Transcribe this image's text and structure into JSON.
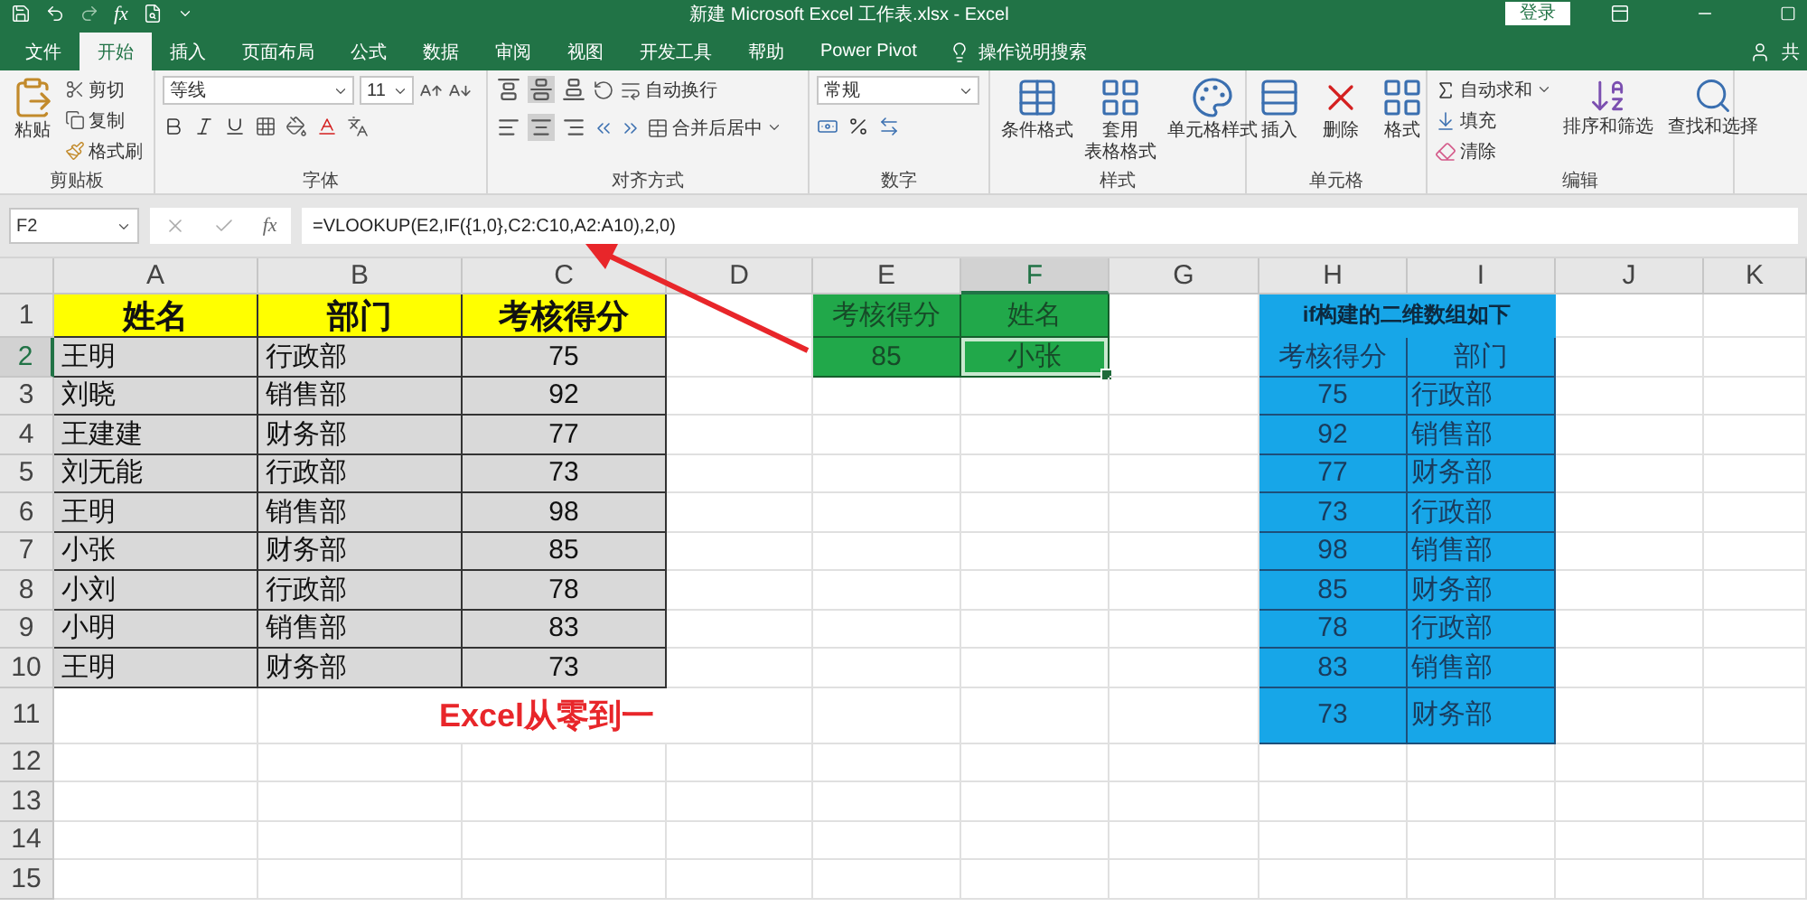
{
  "window": {
    "title": "新建 Microsoft Excel 工作表.xlsx  -  Excel",
    "sign_in": "登录",
    "quick_fx": "fx"
  },
  "tabs": [
    {
      "label": "文件",
      "selected": false
    },
    {
      "label": "开始",
      "selected": true
    },
    {
      "label": "插入",
      "selected": false
    },
    {
      "label": "页面布局",
      "selected": false
    },
    {
      "label": "公式",
      "selected": false
    },
    {
      "label": "数据",
      "selected": false
    },
    {
      "label": "审阅",
      "selected": false
    },
    {
      "label": "视图",
      "selected": false
    },
    {
      "label": "开发工具",
      "selected": false
    },
    {
      "label": "帮助",
      "selected": false
    },
    {
      "label": "Power Pivot",
      "selected": false
    }
  ],
  "tell_me": "操作说明搜索",
  "share": "共",
  "ribbon": {
    "clipboard": {
      "label": "剪贴板",
      "paste": "粘贴",
      "cut": "剪切",
      "copy": "复制",
      "painter": "格式刷"
    },
    "font": {
      "label": "字体",
      "font_name": "等线",
      "font_size": "11"
    },
    "alignment": {
      "label": "对齐方式",
      "wrap": "自动换行",
      "merge": "合并后居中"
    },
    "number": {
      "label": "数字",
      "format": "常规"
    },
    "styles": {
      "label": "样式",
      "conditional": "条件格式",
      "table": [
        "套用",
        "表格格式"
      ],
      "cell": "单元格样式"
    },
    "cells": {
      "label": "单元格",
      "insert": "插入",
      "delete": "删除",
      "format": "格式"
    },
    "editing": {
      "label": "编辑",
      "autosum": "自动求和",
      "fill": "填充",
      "clear": "清除",
      "sort": "排序和筛选",
      "find": "查找和选择"
    }
  },
  "formula_bar": {
    "name_box": "F2",
    "fx": "fx",
    "formula": "=VLOOKUP(E2,IF({1,0},C2:C10,A2:A10),2,0)"
  },
  "sheet": {
    "columns": [
      {
        "label": "A",
        "selected": false
      },
      {
        "label": "B",
        "selected": false
      },
      {
        "label": "C",
        "selected": false
      },
      {
        "label": "D",
        "selected": false
      },
      {
        "label": "E",
        "selected": false
      },
      {
        "label": "F",
        "selected": true
      },
      {
        "label": "G",
        "selected": false
      },
      {
        "label": "H",
        "selected": false
      },
      {
        "label": "I",
        "selected": false
      },
      {
        "label": "J",
        "selected": false
      },
      {
        "label": "K",
        "selected": false
      }
    ],
    "rows": [
      {
        "number": "1",
        "selected": false,
        "cells": [
          {
            "kind": "yellow-head",
            "text": "姓名"
          },
          {
            "kind": "yellow-head",
            "text": "部门"
          },
          {
            "kind": "yellow-head",
            "text": "考核得分"
          },
          {
            "kind": "blank"
          },
          {
            "kind": "green",
            "text": "考核得分"
          },
          {
            "kind": "green",
            "text": "姓名"
          },
          {
            "kind": "blank"
          },
          {
            "kind": "blue-title",
            "text": "if构建的二维数组如下"
          }
        ]
      },
      {
        "number": "2",
        "selected": true,
        "cells": [
          {
            "kind": "gray",
            "text": "王明"
          },
          {
            "kind": "gray",
            "text": "行政部"
          },
          {
            "kind": "gray-num",
            "text": "75"
          },
          {
            "kind": "blank"
          },
          {
            "kind": "green",
            "text": "85"
          },
          {
            "kind": "green-selected",
            "text": "小张"
          },
          {
            "kind": "blank"
          },
          {
            "kind": "blue-num",
            "text": "考核得分"
          },
          {
            "kind": "blue-num",
            "text": "部门"
          }
        ]
      },
      {
        "number": "3",
        "selected": false,
        "cells": [
          {
            "kind": "gray",
            "text": "刘晓"
          },
          {
            "kind": "gray",
            "text": "销售部"
          },
          {
            "kind": "gray-num",
            "text": "92"
          },
          {
            "kind": "blank"
          },
          {
            "kind": "blank"
          },
          {
            "kind": "blank"
          },
          {
            "kind": "blank"
          },
          {
            "kind": "blue-num",
            "text": "75"
          },
          {
            "kind": "blue",
            "text": "行政部"
          }
        ]
      },
      {
        "number": "4",
        "selected": false,
        "cells": [
          {
            "kind": "gray",
            "text": "王建建"
          },
          {
            "kind": "gray",
            "text": "财务部"
          },
          {
            "kind": "gray-num",
            "text": "77"
          },
          {
            "kind": "blank"
          },
          {
            "kind": "blank"
          },
          {
            "kind": "blank"
          },
          {
            "kind": "blank"
          },
          {
            "kind": "blue-num",
            "text": "92"
          },
          {
            "kind": "blue",
            "text": "销售部"
          }
        ]
      },
      {
        "number": "5",
        "selected": false,
        "cells": [
          {
            "kind": "gray",
            "text": "刘无能"
          },
          {
            "kind": "gray",
            "text": "行政部"
          },
          {
            "kind": "gray-num",
            "text": "73"
          },
          {
            "kind": "blank"
          },
          {
            "kind": "blank"
          },
          {
            "kind": "blank"
          },
          {
            "kind": "blank"
          },
          {
            "kind": "blue-num",
            "text": "77"
          },
          {
            "kind": "blue",
            "text": "财务部"
          }
        ]
      },
      {
        "number": "6",
        "selected": false,
        "cells": [
          {
            "kind": "gray",
            "text": "王明"
          },
          {
            "kind": "gray",
            "text": "销售部"
          },
          {
            "kind": "gray-num",
            "text": "98"
          },
          {
            "kind": "blank"
          },
          {
            "kind": "blank"
          },
          {
            "kind": "blank"
          },
          {
            "kind": "blank"
          },
          {
            "kind": "blue-num",
            "text": "73"
          },
          {
            "kind": "blue",
            "text": "行政部"
          }
        ]
      },
      {
        "number": "7",
        "selected": false,
        "cells": [
          {
            "kind": "gray",
            "text": "小张"
          },
          {
            "kind": "gray",
            "text": "财务部"
          },
          {
            "kind": "gray-num",
            "text": "85"
          },
          {
            "kind": "blank"
          },
          {
            "kind": "blank"
          },
          {
            "kind": "blank"
          },
          {
            "kind": "blank"
          },
          {
            "kind": "blue-num",
            "text": "98"
          },
          {
            "kind": "blue",
            "text": "销售部"
          }
        ]
      },
      {
        "number": "8",
        "selected": false,
        "cells": [
          {
            "kind": "gray",
            "text": "小刘"
          },
          {
            "kind": "gray",
            "text": "行政部"
          },
          {
            "kind": "gray-num",
            "text": "78"
          },
          {
            "kind": "blank"
          },
          {
            "kind": "blank"
          },
          {
            "kind": "blank"
          },
          {
            "kind": "blank"
          },
          {
            "kind": "blue-num",
            "text": "85"
          },
          {
            "kind": "blue",
            "text": "财务部"
          }
        ]
      },
      {
        "number": "9",
        "selected": false,
        "cells": [
          {
            "kind": "gray",
            "text": "小明"
          },
          {
            "kind": "gray",
            "text": "销售部"
          },
          {
            "kind": "gray-num",
            "text": "83"
          },
          {
            "kind": "blank"
          },
          {
            "kind": "blank"
          },
          {
            "kind": "blank"
          },
          {
            "kind": "blank"
          },
          {
            "kind": "blue-num",
            "text": "78"
          },
          {
            "kind": "blue",
            "text": "行政部"
          }
        ]
      },
      {
        "number": "10",
        "selected": false,
        "cells": [
          {
            "kind": "gray",
            "text": "王明"
          },
          {
            "kind": "gray",
            "text": "财务部"
          },
          {
            "kind": "gray-num",
            "text": "73"
          },
          {
            "kind": "blank"
          },
          {
            "kind": "blank"
          },
          {
            "kind": "blank"
          },
          {
            "kind": "blank"
          },
          {
            "kind": "blue-num",
            "text": "83"
          },
          {
            "kind": "blue",
            "text": "销售部"
          }
        ]
      },
      {
        "number": "11",
        "selected": false,
        "cells": [
          {
            "kind": "blank"
          },
          {
            "kind": "note",
            "text": "Excel从零到一"
          },
          {
            "kind": "blank"
          },
          {
            "kind": "blank"
          },
          {
            "kind": "blank"
          },
          {
            "kind": "blue-num",
            "text": "73"
          },
          {
            "kind": "blue",
            "text": "财务部"
          }
        ]
      },
      {
        "number": "12",
        "selected": false
      },
      {
        "number": "13",
        "selected": false
      },
      {
        "number": "14",
        "selected": false
      },
      {
        "number": "15",
        "selected": false
      }
    ]
  }
}
